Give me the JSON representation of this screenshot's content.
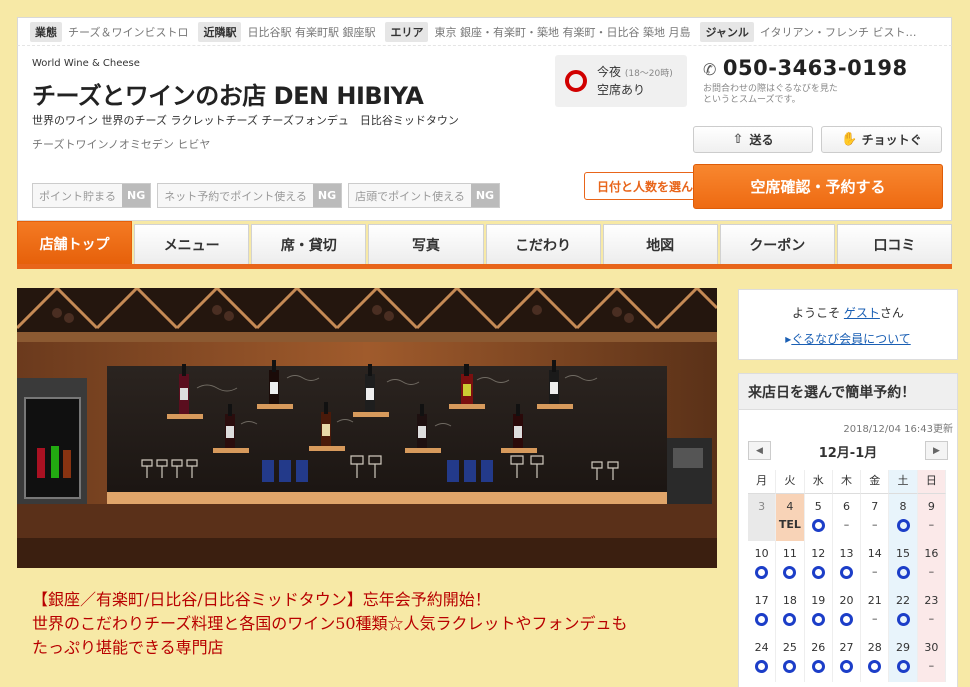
{
  "catbar": [
    {
      "label": "業態",
      "value": "チーズ＆ワインビストロ"
    },
    {
      "label": "近隣駅",
      "value": "日比谷駅 有楽町駅 銀座駅"
    },
    {
      "label": "エリア",
      "value": "東京 銀座・有楽町・築地 有楽町・日比谷 築地 月島"
    },
    {
      "label": "ジャンル",
      "value": "イタリアン・フレンチ ビスト…"
    }
  ],
  "header": {
    "subtitle": "World Wine & Cheese",
    "title": "チーズとワインのお店 DEN HIBIYA",
    "tags": "世界のワイン 世界のチーズ ラクレットチーズ チーズフォンデュ　日比谷ミッドタウン",
    "kana": "チーズトワインノオミセデン ヒビヤ",
    "points": [
      {
        "label": "ポイント貯まる",
        "status": "NG"
      },
      {
        "label": "ネット予約でポイント使える",
        "status": "NG"
      },
      {
        "label": "店頭でポイント使える",
        "status": "NG"
      }
    ],
    "seat": {
      "line1": "今夜",
      "hours": "(18～20時)",
      "line2": "空席あり"
    },
    "phone": "050-3463-0198",
    "phone_note": "お問合わせの際はぐるなびを見た\nというとスムーズです。",
    "send_label": "送る",
    "check_label": "チョットぐ",
    "callout": "日付と人数を選んで",
    "reserve_label": "空席確認・予約する"
  },
  "tabs": [
    "店舗トップ",
    "メニュー",
    "席・貸切",
    "写真",
    "こだわり",
    "地図",
    "クーポン",
    "口コミ"
  ],
  "catchcopy": {
    "line1": "【銀座／有楽町/日比谷/日比谷ミッドタウン】忘年会予約開始！",
    "line2": "世界のこだわりチーズ料理と各国のワイン50種類☆人気ラクレットやフォンデュも",
    "line3": "たっぷり堪能できる専門店"
  },
  "welcome": {
    "prefix": "ようこそ ",
    "guest": "ゲスト",
    "suffix": "さん",
    "member_link": "ぐるなび会員について"
  },
  "calendar": {
    "title": "来店日を選んで簡単予約！",
    "updated": "2018/12/04 16:43更新",
    "month": "12月-1月",
    "prev": "◀",
    "next": "▶",
    "weekdays": [
      "月",
      "火",
      "水",
      "木",
      "金",
      "土",
      "日"
    ],
    "weeks": [
      [
        {
          "d": "3",
          "s": "",
          "t": "past"
        },
        {
          "d": "4",
          "s": "TEL",
          "t": "today"
        },
        {
          "d": "5",
          "s": "o"
        },
        {
          "d": "6",
          "s": "-"
        },
        {
          "d": "7",
          "s": "-"
        },
        {
          "d": "8",
          "s": "o",
          "t": "sat"
        },
        {
          "d": "9",
          "s": "-",
          "t": "sun"
        }
      ],
      [
        {
          "d": "10",
          "s": "o"
        },
        {
          "d": "11",
          "s": "o"
        },
        {
          "d": "12",
          "s": "o"
        },
        {
          "d": "13",
          "s": "o"
        },
        {
          "d": "14",
          "s": "-"
        },
        {
          "d": "15",
          "s": "o",
          "t": "sat"
        },
        {
          "d": "16",
          "s": "-",
          "t": "sun"
        }
      ],
      [
        {
          "d": "17",
          "s": "o"
        },
        {
          "d": "18",
          "s": "o"
        },
        {
          "d": "19",
          "s": "o"
        },
        {
          "d": "20",
          "s": "o"
        },
        {
          "d": "21",
          "s": "-"
        },
        {
          "d": "22",
          "s": "o",
          "t": "sat"
        },
        {
          "d": "23",
          "s": "-",
          "t": "sun"
        }
      ],
      [
        {
          "d": "24",
          "s": "o"
        },
        {
          "d": "25",
          "s": "o"
        },
        {
          "d": "26",
          "s": "o"
        },
        {
          "d": "27",
          "s": "o"
        },
        {
          "d": "28",
          "s": "o"
        },
        {
          "d": "29",
          "s": "o",
          "t": "sat"
        },
        {
          "d": "30",
          "s": "-",
          "t": "sun"
        }
      ]
    ]
  },
  "colors": {
    "accent": "#ee6a12",
    "background": "#f7e9a6",
    "catch": "#b80000",
    "link": "#1a5fb4",
    "available": "#1c3ec8"
  }
}
